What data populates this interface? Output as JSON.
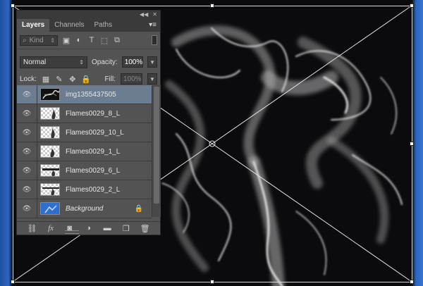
{
  "panel": {
    "tabs": [
      {
        "label": "Layers",
        "active": true
      },
      {
        "label": "Channels",
        "active": false
      },
      {
        "label": "Paths",
        "active": false
      }
    ],
    "filter": {
      "kind_label": "Kind"
    },
    "blend_mode": "Normal",
    "opacity_label": "Opacity:",
    "opacity_value": "100%",
    "lock_label": "Lock:",
    "fill_label": "Fill:",
    "fill_value": "100%",
    "layers": [
      {
        "name": "img1355437505",
        "thumb": "dark",
        "selected": true
      },
      {
        "name": "Flames0029_8_L",
        "thumb": "checker",
        "selected": false
      },
      {
        "name": "Flames0029_10_L",
        "thumb": "checker",
        "selected": false
      },
      {
        "name": "Flames0029_1_L",
        "thumb": "checker",
        "selected": false
      },
      {
        "name": "Flames0029_6_L",
        "thumb": "checker",
        "selected": false
      },
      {
        "name": "Flames0029_2_L",
        "thumb": "checker",
        "selected": false
      },
      {
        "name": "Background",
        "thumb": "blue",
        "selected": false,
        "locked": true
      }
    ],
    "footer_icons": [
      "link-icon",
      "fx-icon",
      "mask-icon",
      "adjustment-icon",
      "folder-icon",
      "new-layer-icon",
      "trash-icon"
    ]
  },
  "colors": {
    "panel_bg": "#535353",
    "selected_layer": "#6c7d92",
    "canvas_edge_blue": "#2c66c4"
  }
}
